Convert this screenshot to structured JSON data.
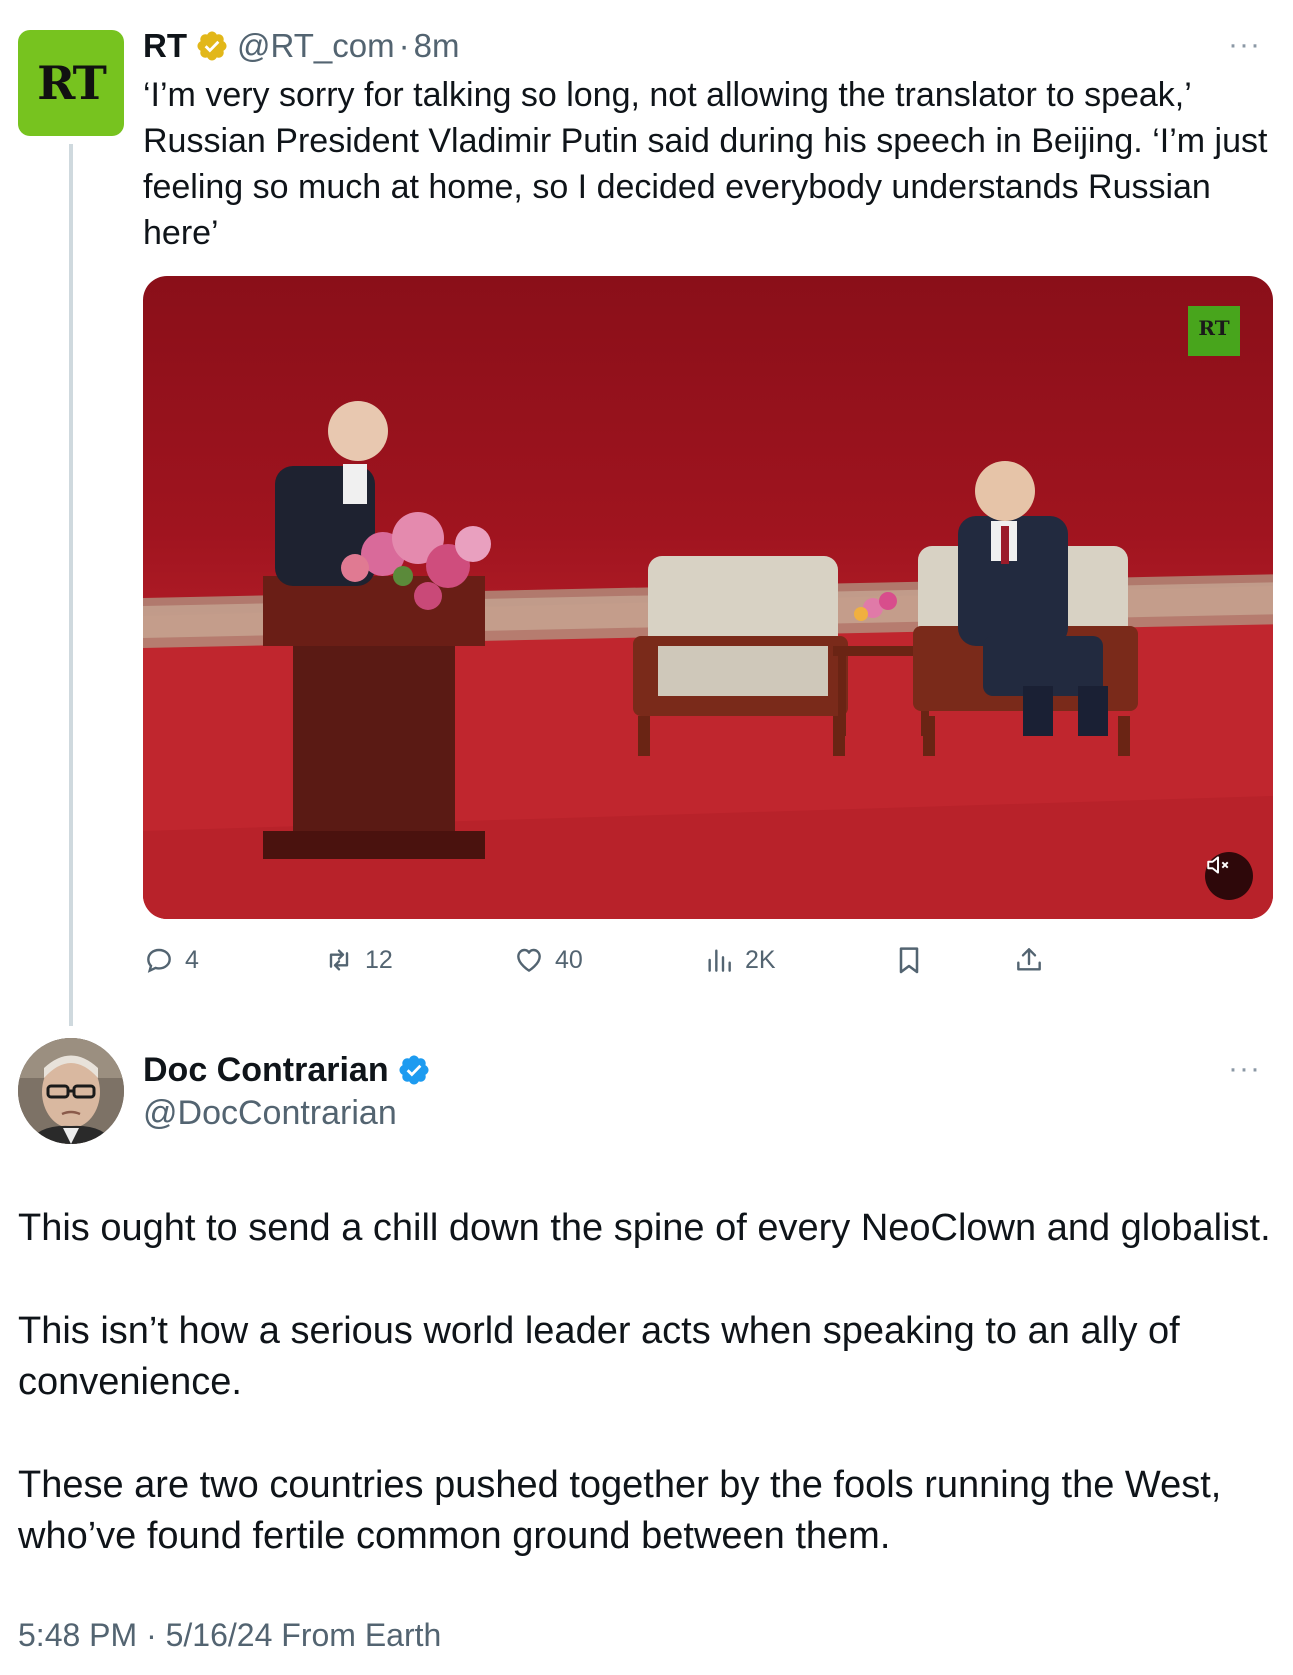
{
  "quoted_tweet": {
    "avatar_text": "RT",
    "display_name": "RT",
    "handle": "@RT_com",
    "separator": "·",
    "time_ago": "8m",
    "text": "‘I’m very sorry for talking so long, not allowing the translator to speak,’ Russian President Vladimir Putin said during his speech in Beijing. ‘I’m just feeling so much at home, so I decided everybody understands Russian here’",
    "video": {
      "watermark": "RT",
      "muted": true
    },
    "stats": {
      "replies": "4",
      "reposts": "12",
      "likes": "40",
      "views": "2K"
    }
  },
  "tweet": {
    "display_name": "Doc Contrarian",
    "handle": "@DocContrarian",
    "paragraphs": [
      "This ought to send a chill down the spine of every NeoClown and globalist.",
      "This isn’t how a serious world leader acts when speaking to an ally of convenience.",
      "These are two countries pushed together by the fools running the West, who’ve found fertile common ground between them."
    ],
    "timestamp": "5:48 PM · 5/16/24 From Earth"
  },
  "more_menu_label": "···",
  "colors": {
    "rt_green": "#77c31f",
    "verified_blue": "#1d9bf0",
    "verified_gold": "#e2b719",
    "muted": "#536471"
  }
}
